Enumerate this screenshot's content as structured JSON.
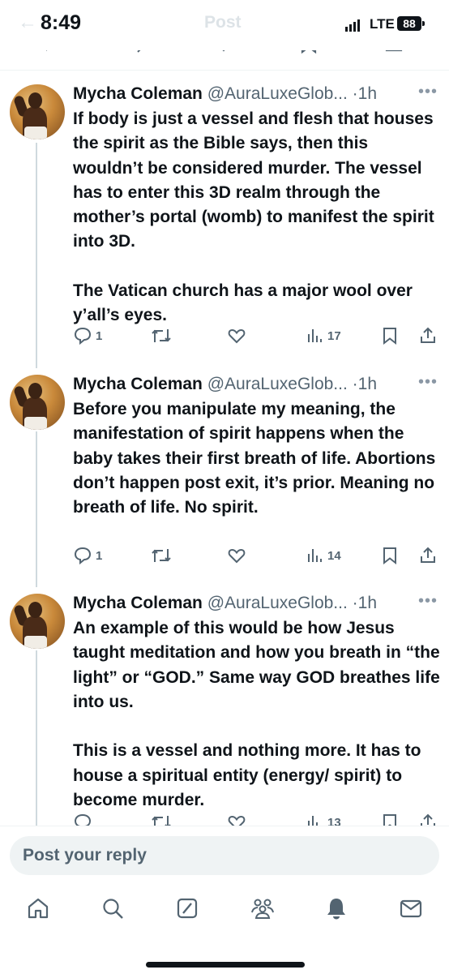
{
  "status_bar": {
    "time": "8:49",
    "network": "LTE",
    "battery": "88"
  },
  "header": {
    "title": "Post"
  },
  "tweets": [
    {
      "name": "Mycha Coleman",
      "handle": "@AuraLuxeGlob...",
      "dot": "·",
      "time": "1h",
      "text": "If body is just a vessel and flesh that houses the spirit as the Bible says, then this wouldn’t be considered murder. The vessel has to enter this 3D realm through the mother’s portal (womb) to manifest the spirit into 3D.\n\nThe Vatican church has a major wool over y’all’s eyes.",
      "replies": "1",
      "reposts": "",
      "likes": "",
      "views": "17"
    },
    {
      "name": "Mycha Coleman",
      "handle": "@AuraLuxeGlob...",
      "dot": "·",
      "time": "1h",
      "text": "Before you manipulate my meaning, the manifestation of spirit happens when the baby takes their first breath of life. Abortions don’t happen post exit, it’s prior. Meaning no breath of life. No spirit.",
      "replies": "1",
      "reposts": "",
      "likes": "",
      "views": "14"
    },
    {
      "name": "Mycha Coleman",
      "handle": "@AuraLuxeGlob...",
      "dot": "·",
      "time": "1h",
      "text": "An example of this would be how Jesus taught meditation and how you breath in “the light” or “GOD.” Same way GOD breathes life into us.\n\nThis is a vessel and nothing more. It has to house a spiritual entity (energy/ spirit) to become murder.",
      "replies": "",
      "reposts": "",
      "likes": "",
      "views": "13"
    }
  ],
  "reply_box": {
    "placeholder": "Post your reply"
  },
  "nav": {
    "items": [
      "home-icon",
      "search-icon",
      "grok-icon",
      "communities-icon",
      "notifications-icon",
      "messages-icon"
    ]
  },
  "colors": {
    "text": "#0f1419",
    "secondary": "#536471",
    "divider": "#eff3f4",
    "thread_line": "#cfd9de"
  }
}
